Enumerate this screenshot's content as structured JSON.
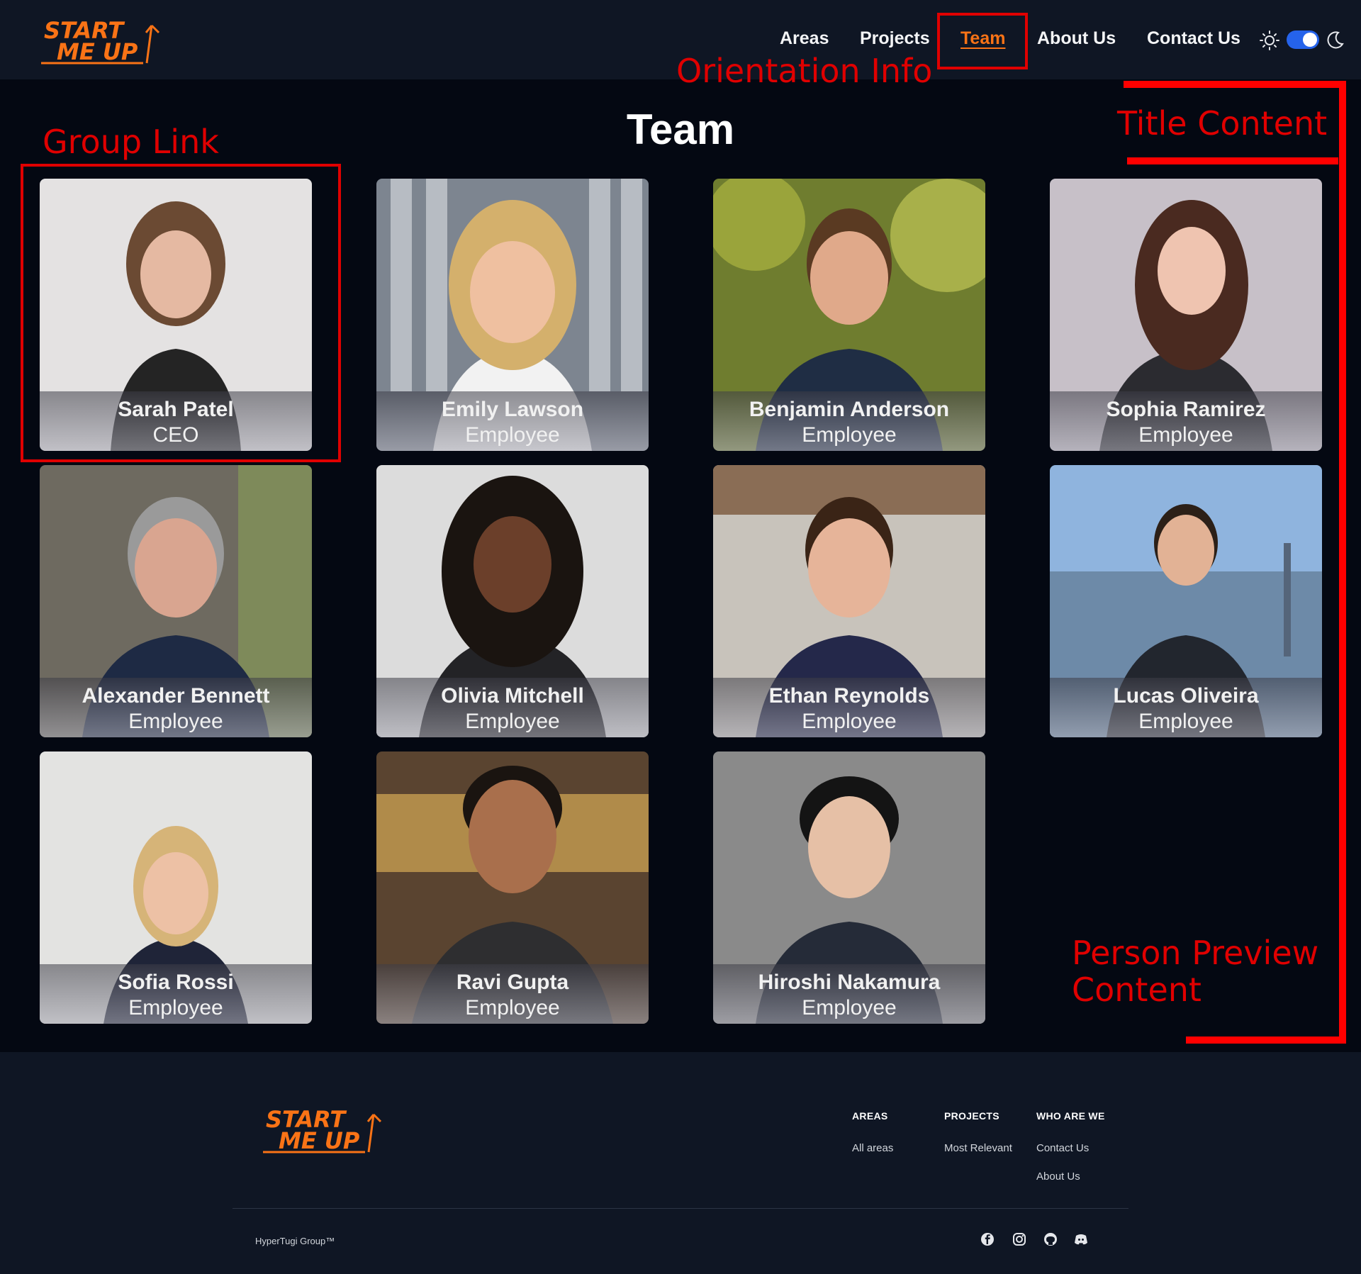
{
  "header": {
    "logo_line1": "START",
    "logo_line2": "ME UP",
    "nav": [
      "Areas",
      "Projects",
      "Team",
      "About Us",
      "Contact Us"
    ],
    "active_nav": "Team",
    "theme_toggle": "on"
  },
  "page": {
    "title": "Team"
  },
  "team": [
    {
      "name": "Sarah Patel",
      "role": "CEO"
    },
    {
      "name": "Emily Lawson",
      "role": "Employee"
    },
    {
      "name": "Benjamin Anderson",
      "role": "Employee"
    },
    {
      "name": "Sophia Ramirez",
      "role": "Employee"
    },
    {
      "name": "Alexander Bennett",
      "role": "Employee"
    },
    {
      "name": "Olivia Mitchell",
      "role": "Employee"
    },
    {
      "name": "Ethan Reynolds",
      "role": "Employee"
    },
    {
      "name": "Lucas Oliveira",
      "role": "Employee"
    },
    {
      "name": "Sofia Rossi",
      "role": "Employee"
    },
    {
      "name": "Ravi Gupta",
      "role": "Employee"
    },
    {
      "name": "Hiroshi Nakamura",
      "role": "Employee"
    }
  ],
  "annotations": {
    "orientation": "Orientation Info",
    "title_content": "Title Content",
    "group_link": "Group Link",
    "person_preview_1": "Person Preview",
    "person_preview_2": "Content"
  },
  "footer": {
    "columns": [
      {
        "heading": "AREAS",
        "links": [
          "All areas"
        ]
      },
      {
        "heading": "PROJECTS",
        "links": [
          "Most Relevant"
        ]
      },
      {
        "heading": "WHO ARE WE",
        "links": [
          "Contact Us",
          "About Us"
        ]
      }
    ],
    "copyright": "HyperTugi Group™",
    "social_icons": [
      "facebook-icon",
      "instagram-icon",
      "github-icon",
      "discord-icon"
    ]
  },
  "colors": {
    "accent": "#f97316",
    "annotation": "#e00000",
    "toggle": "#2563eb"
  }
}
